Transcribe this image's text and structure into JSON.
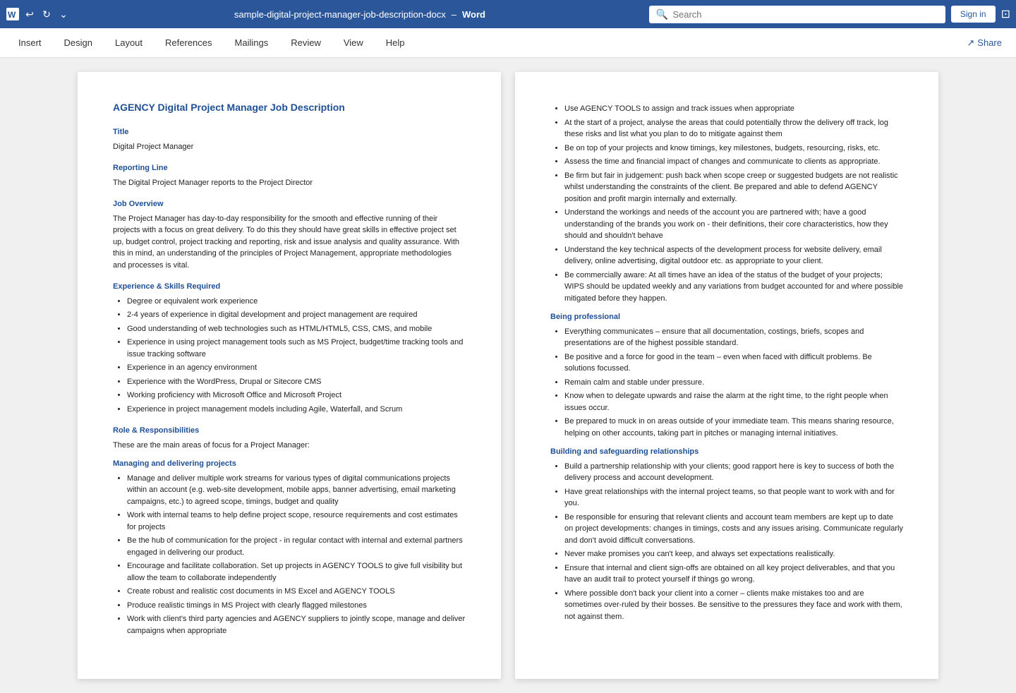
{
  "titlebar": {
    "doc_title": "sample-digital-project-manager-job-description-docx",
    "separator": "–",
    "app_name": "Word",
    "search_placeholder": "Search",
    "sign_in_label": "Sign in"
  },
  "ribbon": {
    "tabs": [
      "Insert",
      "Design",
      "Layout",
      "References",
      "Mailings",
      "Review",
      "View",
      "Help"
    ],
    "share_label": "Share"
  },
  "page_left": {
    "doc_heading": "AGENCY Digital Project Manager Job Description",
    "title_label": "Title",
    "title_value": "Digital Project Manager",
    "reporting_line_label": "Reporting Line",
    "reporting_line_value": "The Digital Project Manager reports to the Project Director",
    "job_overview_label": "Job Overview",
    "job_overview_text": "The Project Manager has day-to-day responsibility for the smooth and effective running of their projects with a focus on great delivery. To do this they should have great skills in effective project set up, budget control, project tracking and reporting, risk and issue analysis and quality assurance. With this in mind, an understanding of the principles of Project Management, appropriate methodologies and processes is vital.",
    "exp_skills_label": "Experience & Skills Required",
    "exp_skills_items": [
      "Degree or equivalent work experience",
      "2-4 years of experience in digital development and project management are required",
      "Good understanding of web technologies such as HTML/HTML5, CSS, CMS, and mobile",
      "Experience in using project management tools such as MS Project, budget/time tracking tools and issue tracking software",
      "Experience in an agency environment",
      "Experience with the WordPress, Drupal or Sitecore CMS",
      "Working proficiency with Microsoft Office and Microsoft Project",
      "Experience in project management models including Agile, Waterfall, and Scrum"
    ],
    "role_resp_label": "Role & Responsibilities",
    "role_resp_intro": "These are the main areas of focus for a Project Manager:",
    "managing_label": "Managing and delivering projects",
    "managing_items": [
      "Manage and deliver multiple work streams for various types of digital communications projects within an account (e.g. web-site development, mobile apps, banner advertising, email marketing campaigns, etc.) to agreed scope, timings, budget and quality",
      "Work with internal teams to help define project scope, resource requirements and cost estimates for projects",
      "Be the hub of communication for the project - in regular contact with internal and external partners engaged in delivering our product.",
      "Encourage and facilitate collaboration. Set up projects in AGENCY TOOLS to give full visibility but allow the team to collaborate independently",
      "Create robust and realistic cost documents in MS Excel and AGENCY TOOLS",
      "Produce realistic timings in MS Project with clearly flagged milestones",
      "Work with client's third party agencies and AGENCY suppliers to jointly scope, manage and deliver campaigns when appropriate"
    ]
  },
  "page_right": {
    "risk_items": [
      "Use AGENCY TOOLS to assign and track issues when appropriate",
      "At the start of a project, analyse the areas that could potentially throw the delivery off track, log these risks and list what you plan to do to mitigate against them",
      "Be on top of your projects and know timings, key milestones, budgets, resourcing, risks, etc.",
      "Assess the time and financial impact of changes and communicate to clients as appropriate.",
      "Be firm but fair in judgement: push back when scope creep or suggested budgets are not realistic whilst understanding the constraints of the client. Be prepared and able to defend AGENCY position and profit margin internally and externally.",
      "Understand the workings and needs of the account you are partnered with; have a good understanding of the brands you work on - their definitions, their core characteristics, how they should and shouldn't behave",
      "Understand the key technical aspects of the development process for website delivery, email delivery, online advertising, digital outdoor etc. as appropriate to your client.",
      "Be commercially aware: At all times have an idea of the status of the budget of your projects; WIPS should be updated weekly and any variations from budget accounted for and where possible mitigated before they happen."
    ],
    "being_professional_label": "Being professional",
    "being_professional_items": [
      "Everything communicates – ensure that all documentation, costings, briefs, scopes and presentations are of the highest possible standard.",
      "Be positive and a force for good in the team – even when faced with difficult problems. Be solutions focussed.",
      "Remain calm and stable under pressure.",
      "Know when to delegate upwards and raise the alarm at the right time, to the right people when issues occur.",
      "Be prepared to muck in on areas outside of your immediate team. This means sharing resource, helping on other accounts, taking part in pitches or managing internal initiatives."
    ],
    "building_label": "Building and safeguarding relationships",
    "building_items": [
      "Build a partnership relationship with your clients; good rapport here is key to success of both the delivery process and account development.",
      "Have great relationships with the internal project teams, so that people want to work with and for you.",
      "Be responsible for ensuring that relevant clients and account team members are kept up to date on project developments: changes in timings, costs and any issues arising. Communicate regularly and don't avoid difficult conversations.",
      "Never make promises you can't keep, and always set expectations realistically.",
      "Ensure that internal and client sign-offs are obtained on all key project deliverables, and that you have an audit trail to protect yourself if things go wrong.",
      "Where possible don't back your client into a corner – clients make mistakes too and are sometimes over-ruled by their bosses. Be sensitive to the pressures they face and work with them, not against them."
    ]
  }
}
